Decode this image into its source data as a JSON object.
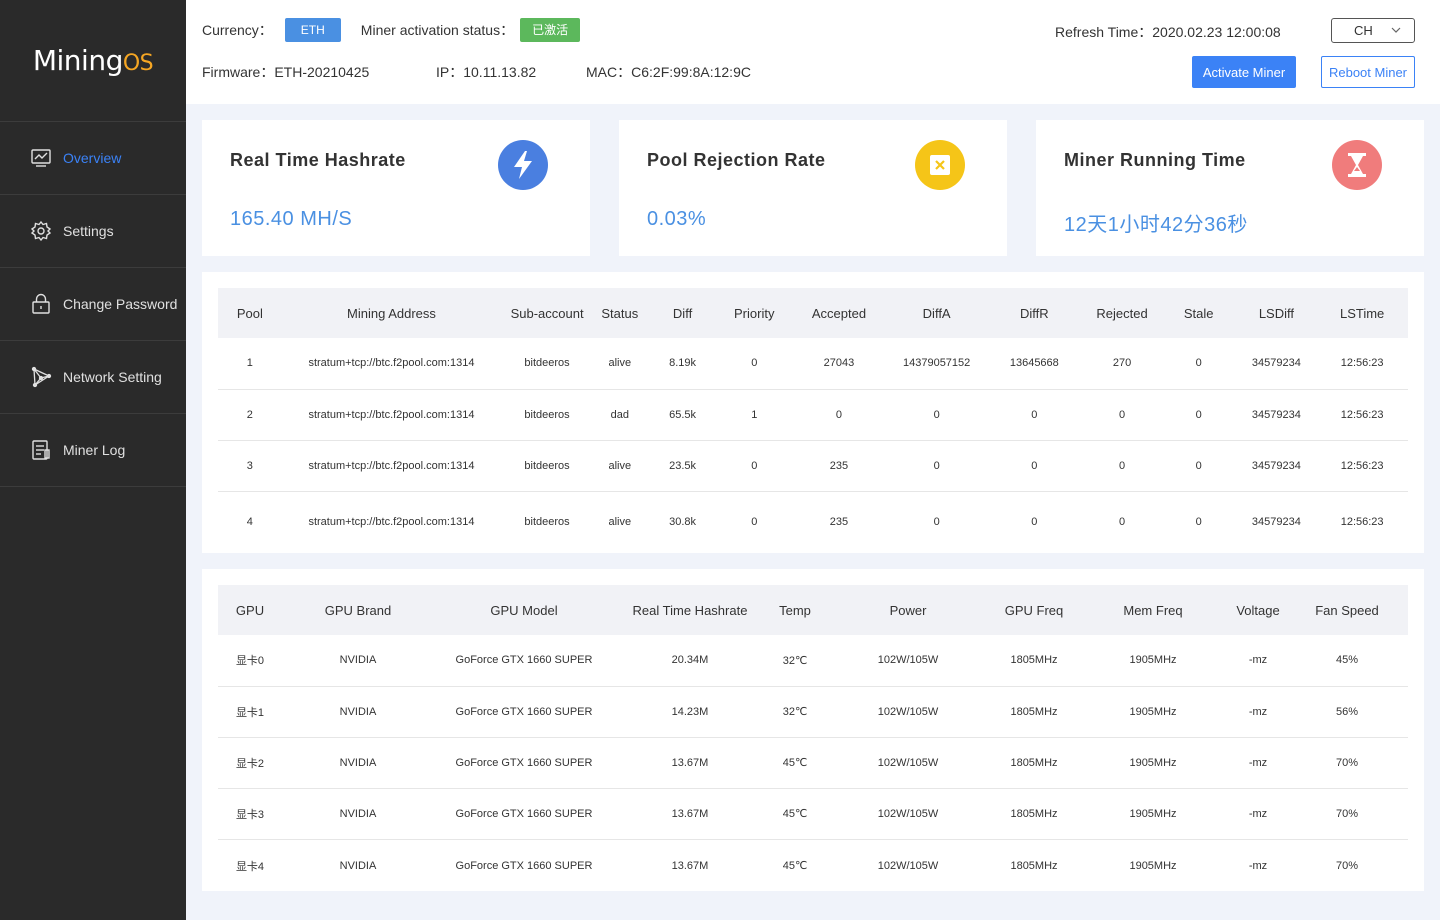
{
  "brand": {
    "logo_main": "Mining",
    "logo_os": "OS"
  },
  "sidebar": {
    "items": [
      {
        "label": "Overview",
        "icon": "monitor-chart-icon",
        "active": true
      },
      {
        "label": "Settings",
        "icon": "gear-icon"
      },
      {
        "label": "Change Password",
        "icon": "lock-icon"
      },
      {
        "label": "Network Setting",
        "icon": "network-icon"
      },
      {
        "label": "Miner Log",
        "icon": "document-icon"
      }
    ]
  },
  "header": {
    "currency_label": "Currency：",
    "currency_value": "ETH",
    "activation_label": "Miner activation status：",
    "activation_value": "已激活",
    "refresh_label": "Refresh Time：",
    "refresh_value": "2020.02.23 12:00:08",
    "language": "CH",
    "firmware_label": "Firmware：",
    "firmware_value": "ETH-20210425",
    "ip_label": "IP：",
    "ip_value": "10.11.13.82",
    "mac_label": "MAC：",
    "mac_value": "C6:2F:99:8A:12:9C",
    "activate_button": "Activate Miner",
    "reboot_button": "Reboot Miner"
  },
  "stats": {
    "hashrate": {
      "title": "Real Time Hashrate",
      "value": "165.40  MH/S",
      "icon": "lightning-icon",
      "color": "#4a7fe0"
    },
    "rejection": {
      "title": "Pool Rejection Rate",
      "value": "0.03%",
      "icon": "reject-icon",
      "color": "#f5c518"
    },
    "running": {
      "title": "Miner Running Time",
      "value": "12天1小时42分36秒",
      "icon": "hourglass-icon",
      "color": "#f07c7c"
    }
  },
  "pool_table": {
    "headers": [
      "Pool",
      "Mining Address",
      "Sub-account",
      "Status",
      "Diff",
      "Priority",
      "Accepted",
      "DiffA",
      "DiffR",
      "Rejected",
      "Stale",
      "LSDiff",
      "LSTime"
    ],
    "rows": [
      [
        "1",
        "stratum+tcp://btc.f2pool.com:1314",
        "bitdeeros",
        "alive",
        "8.19k",
        "0",
        "27043",
        "14379057152",
        "13645668",
        "270",
        "0",
        "34579234",
        "12:56:23"
      ],
      [
        "2",
        "stratum+tcp://btc.f2pool.com:1314",
        "bitdeeros",
        "dad",
        "65.5k",
        "1",
        "0",
        "0",
        "0",
        "0",
        "0",
        "34579234",
        "12:56:23"
      ],
      [
        "3",
        "stratum+tcp://btc.f2pool.com:1314",
        "bitdeeros",
        "alive",
        "23.5k",
        "0",
        "235",
        "0",
        "0",
        "0",
        "0",
        "34579234",
        "12:56:23"
      ],
      [
        "4",
        "stratum+tcp://btc.f2pool.com:1314",
        "bitdeeros",
        "alive",
        "30.8k",
        "0",
        "235",
        "0",
        "0",
        "0",
        "0",
        "34579234",
        "12:56:23"
      ]
    ]
  },
  "gpu_table": {
    "headers": [
      "GPU",
      "GPU Brand",
      "GPU Model",
      "Real Time Hashrate",
      "Temp",
      "Power",
      "GPU Freq",
      "Mem Freq",
      "Voltage",
      "Fan Speed"
    ],
    "rows": [
      [
        "显卡0",
        "NVIDIA",
        "GoForce GTX 1660 SUPER",
        "20.34M",
        "32℃",
        "102W/105W",
        "1805MHz",
        "1905MHz",
        "-mz",
        "45%"
      ],
      [
        "显卡1",
        "NVIDIA",
        "GoForce GTX 1660 SUPER",
        "14.23M",
        "32℃",
        "102W/105W",
        "1805MHz",
        "1905MHz",
        "-mz",
        "56%"
      ],
      [
        "显卡2",
        "NVIDIA",
        "GoForce GTX 1660 SUPER",
        "13.67M",
        "45℃",
        "102W/105W",
        "1805MHz",
        "1905MHz",
        "-mz",
        "70%"
      ],
      [
        "显卡3",
        "NVIDIA",
        "GoForce GTX 1660 SUPER",
        "13.67M",
        "45℃",
        "102W/105W",
        "1805MHz",
        "1905MHz",
        "-mz",
        "70%"
      ],
      [
        "显卡4",
        "NVIDIA",
        "GoForce GTX 1660 SUPER",
        "13.67M",
        "45℃",
        "102W/105W",
        "1805MHz",
        "1905MHz",
        "-mz",
        "70%"
      ]
    ]
  }
}
